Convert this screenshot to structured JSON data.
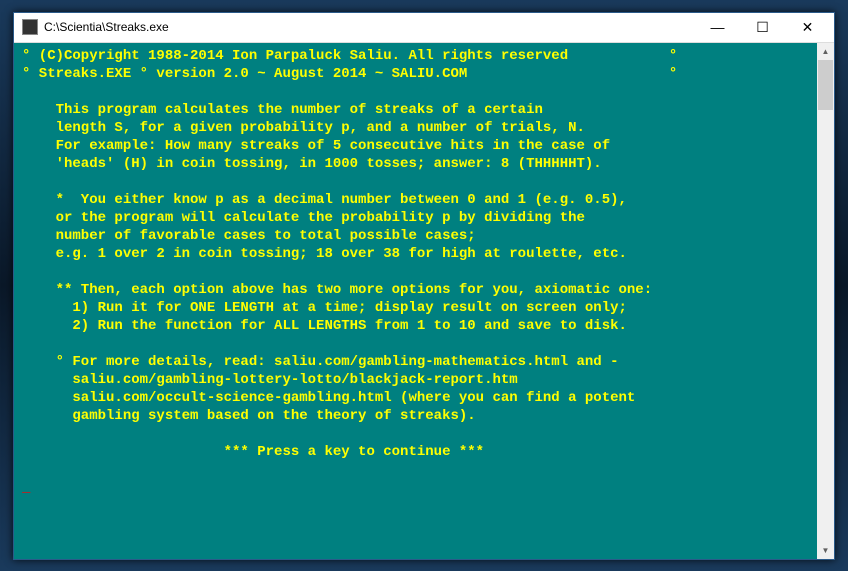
{
  "window": {
    "title": "C:\\Scientia\\Streaks.exe",
    "controls": {
      "minimize": "—",
      "maximize": "☐",
      "close": "✕"
    }
  },
  "console": {
    "line1": "° (C)Copyright 1988-2014 Ion Parpaluck Saliu. All rights reserved            °",
    "line2": "° Streaks.EXE ° version 2.0 ~ August 2014 ~ SALIU.COM                        °",
    "line3": "",
    "line4": "    This program calculates the number of streaks of a certain",
    "line5": "    length S, for a given probability p, and a number of trials, N.",
    "line6": "    For example: How many streaks of 5 consecutive hits in the case of",
    "line7": "    'heads' (H) in coin tossing, in 1000 tosses; answer: 8 (THHHHHT).",
    "line8": "",
    "line9": "    *  You either know p as a decimal number between 0 and 1 (e.g. 0.5),",
    "line10": "    or the program will calculate the probability p by dividing the",
    "line11": "    number of favorable cases to total possible cases;",
    "line12": "    e.g. 1 over 2 in coin tossing; 18 over 38 for high at roulette, etc.",
    "line13": "",
    "line14": "    ** Then, each option above has two more options for you, axiomatic one:",
    "line15": "      1) Run it for ONE LENGTH at a time; display result on screen only;",
    "line16": "      2) Run the function for ALL LENGTHS from 1 to 10 and save to disk.",
    "line17": "",
    "line18": "    ° For more details, read: saliu.com/gambling-mathematics.html and -",
    "line19": "      saliu.com/gambling-lottery-lotto/blackjack-report.htm",
    "line20": "      saliu.com/occult-science-gambling.html (where you can find a potent",
    "line21": "      gambling system based on the theory of streaks).",
    "line22": "",
    "line23": "                        *** Press a key to continue ***",
    "line24": "",
    "cursor": "_"
  },
  "scrollbar": {
    "up": "▲",
    "down": "▼"
  }
}
